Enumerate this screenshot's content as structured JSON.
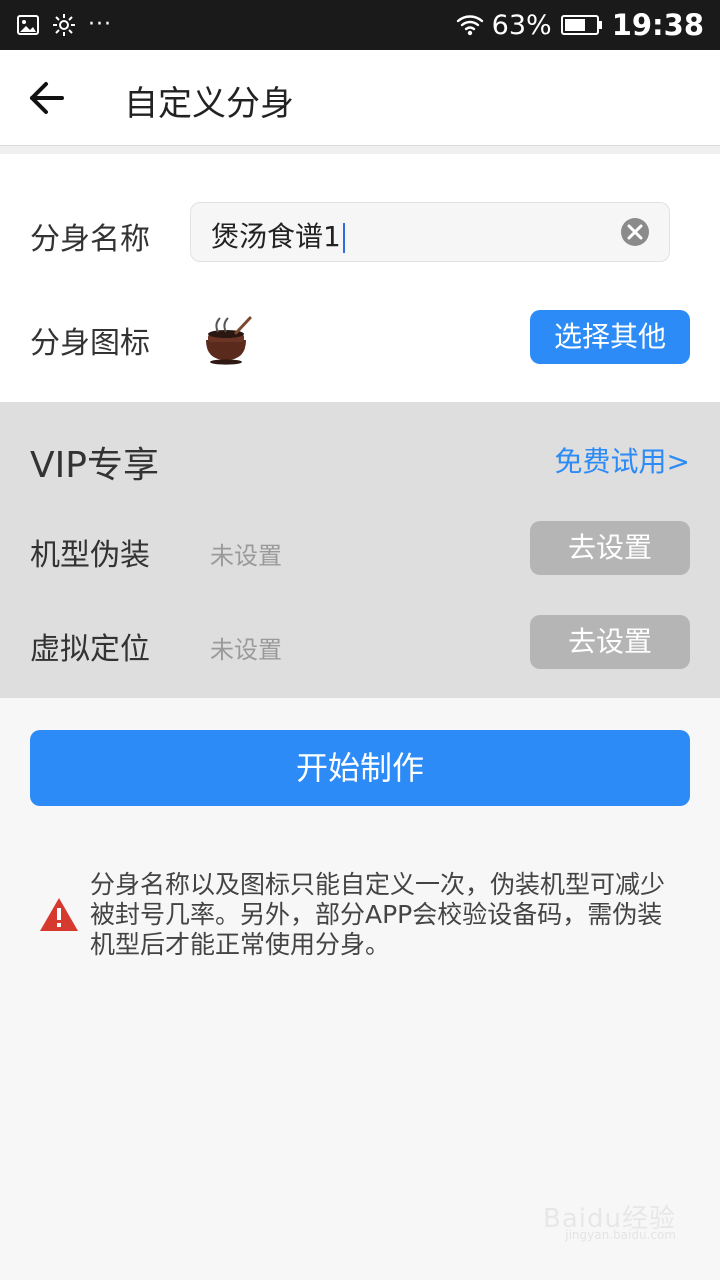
{
  "status_bar": {
    "icons": [
      "image-icon",
      "gear-icon",
      "more-icon"
    ],
    "more_text": "···",
    "wifi_icon": "wifi-icon",
    "battery_percent": "63%",
    "time": "19:38"
  },
  "header": {
    "back_icon": "arrow-left-icon",
    "title": "自定义分身"
  },
  "form": {
    "name_label": "分身名称",
    "name_value": "煲汤食谱1",
    "name_clear_icon": "clear-icon",
    "icon_label": "分身图标",
    "icon_name": "pot-icon",
    "choose_other": "选择其他"
  },
  "vip": {
    "title": "VIP专享",
    "trial_link": "免费试用>",
    "model_label": "机型伪装",
    "model_status": "未设置",
    "model_button": "去设置",
    "location_label": "虚拟定位",
    "location_status": "未设置",
    "location_button": "去设置"
  },
  "actions": {
    "start_button": "开始制作"
  },
  "notice": {
    "icon": "warning-icon",
    "text": "分身名称以及图标只能自定义一次，伪装机型可减少被封号几率。另外，部分APP会校验设备码，需伪装机型后才能正常使用分身。"
  },
  "watermark": {
    "main": "Baidu经验",
    "sub": "jingyan.baidu.com"
  },
  "colors": {
    "primary": "#2c8bf6",
    "status_bg": "#1a1a1a",
    "vip_bg": "#dedede",
    "button_gray": "#b5b5b5",
    "warning": "#d63a2e"
  }
}
